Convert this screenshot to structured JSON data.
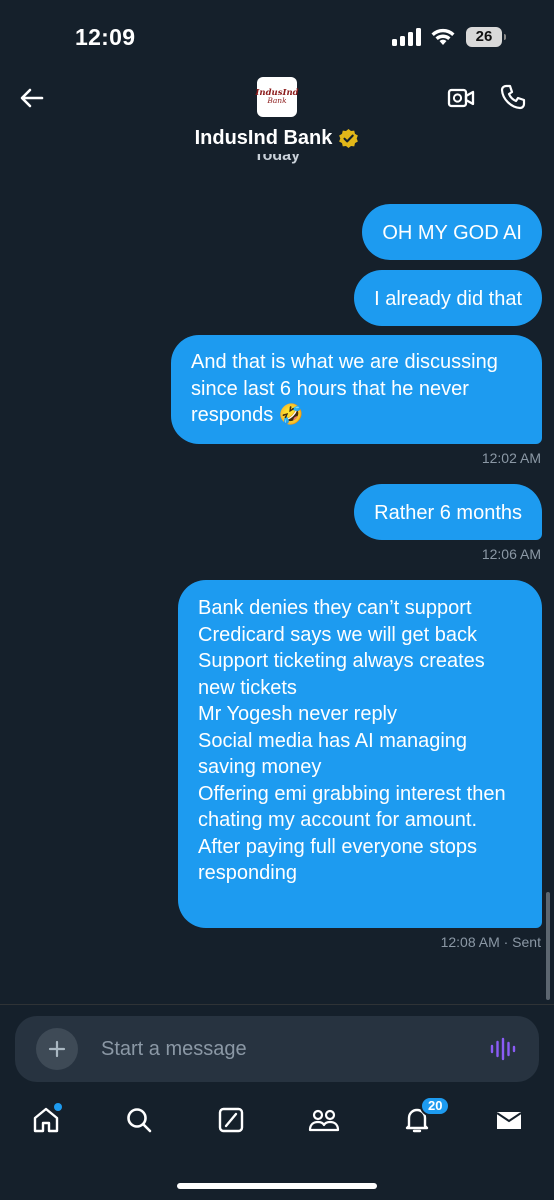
{
  "status_bar": {
    "time": "12:09",
    "battery": "26"
  },
  "header": {
    "logo_top": "IndusInd",
    "logo_bottom": "Bank",
    "name": "IndusInd Bank",
    "date_separator": "Today"
  },
  "messages": [
    {
      "text": "OH MY GOD AI"
    },
    {
      "text": "I already did that"
    },
    {
      "text": "And that is what we are discussing since last 6 hours that he never responds 🤣",
      "time": "12:02 AM"
    },
    {
      "text": "Rather 6 months",
      "time": "12:06 AM"
    },
    {
      "text": "Bank denies they can’t support\nCredicard says we will get back\nSupport ticketing always creates new tickets\nMr Yogesh never reply\nSocial media has AI managing saving money\nOffering emi grabbing interest then chating my account for amount.\nAfter paying full everyone stops responding",
      "time": "12:08 AM · Sent"
    }
  ],
  "composer": {
    "placeholder": "Start a message"
  },
  "tabbar": {
    "notifications_badge": "20"
  },
  "colors": {
    "background": "#15202b",
    "bubble": "#1d9bf0",
    "accent": "#1d9bf0",
    "voice": "#8b5cf6"
  },
  "icons": [
    "back-arrow-icon",
    "verified-badge-icon",
    "video-call-icon",
    "phone-call-icon",
    "plus-icon",
    "voice-wave-icon",
    "home-icon",
    "search-icon",
    "grok-icon",
    "communities-icon",
    "bell-icon",
    "mail-icon"
  ]
}
